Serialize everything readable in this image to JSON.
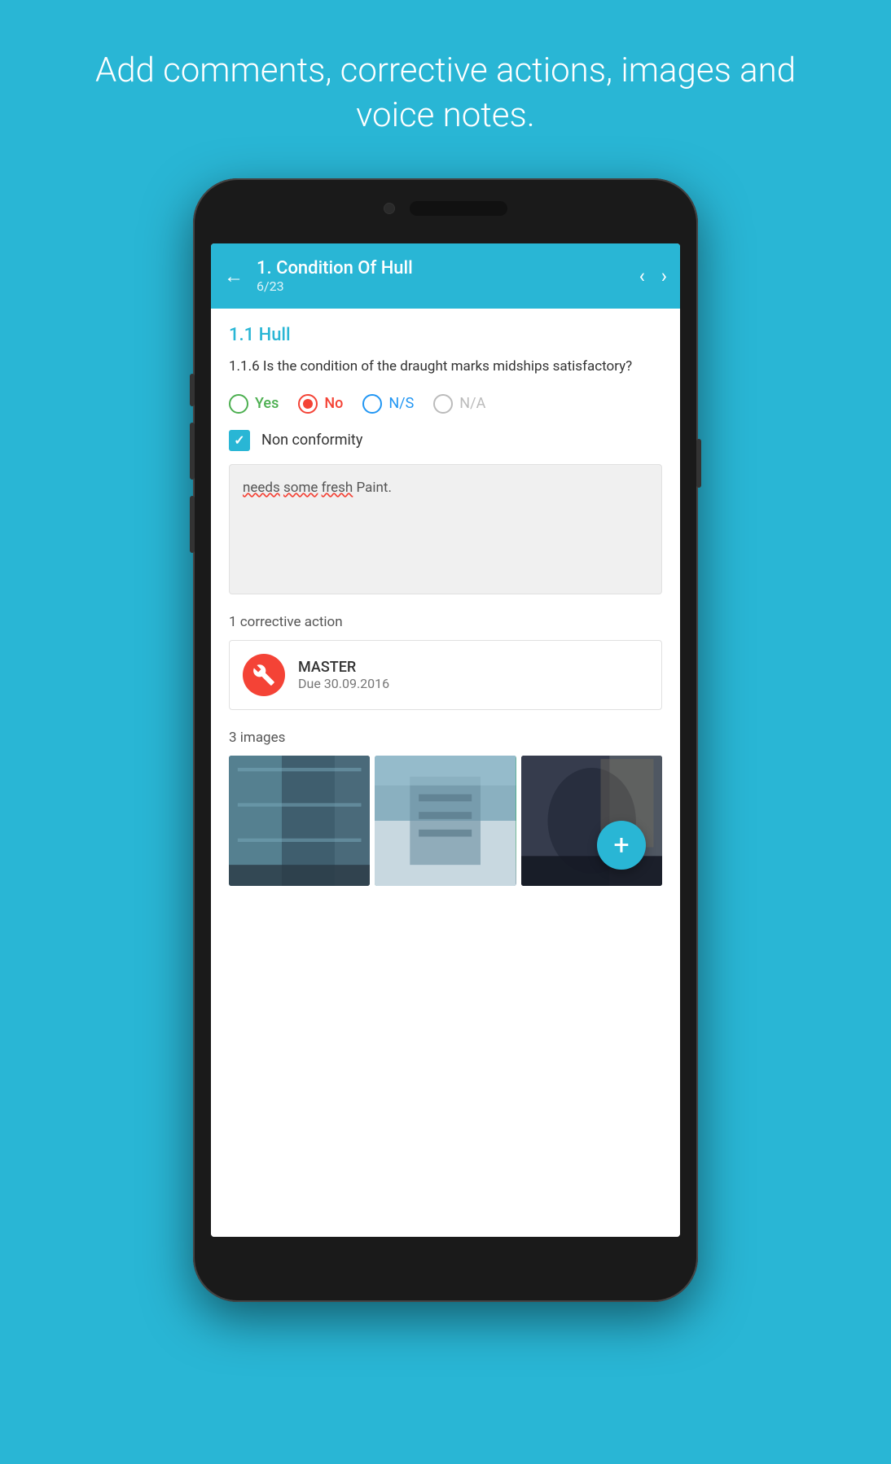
{
  "page": {
    "hero_text": "Add comments, corrective actions, images and voice notes.",
    "bg_color": "#29b6d5"
  },
  "app": {
    "header": {
      "back_label": "←",
      "title": "1. Condition Of Hull",
      "subtitle": "6/23",
      "prev_label": "‹",
      "next_label": "›"
    },
    "section": {
      "title": "1.1 Hull",
      "question": "1.1.6 Is the condition of the draught marks midships satisfactory?"
    },
    "answers": {
      "yes_label": "Yes",
      "no_label": "No",
      "ns_label": "N/S",
      "na_label": "N/A",
      "selected": "No"
    },
    "checkbox": {
      "label": "Non conformity",
      "checked": true
    },
    "comment": {
      "text": "needs some fresh Paint.",
      "underlined_words": [
        "needs",
        "some",
        "fresh"
      ]
    },
    "corrective_actions": {
      "label": "1 corrective action",
      "items": [
        {
          "name": "MASTER",
          "due": "Due 30.09.2016"
        }
      ]
    },
    "images": {
      "label": "3 images",
      "count": 3
    },
    "fab": {
      "label": "+"
    }
  }
}
